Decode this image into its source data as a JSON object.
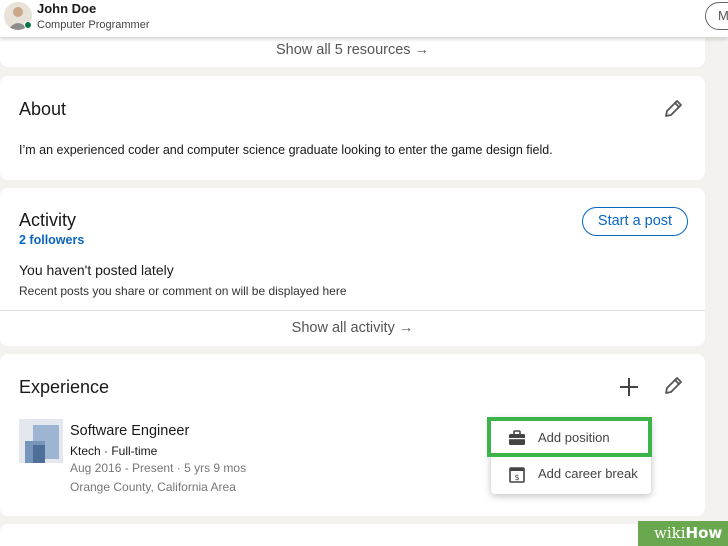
{
  "header": {
    "name": "John Doe",
    "headline": "Computer Programmer",
    "more_button_label": "M"
  },
  "resources": {
    "show_all_label": "Show all 5 resources",
    "arrow": "→"
  },
  "about": {
    "title": "About",
    "text": "I’m an experienced coder and computer science graduate looking to enter the game design field.",
    "edit_icon": "pencil-icon"
  },
  "activity": {
    "title": "Activity",
    "followers": "2 followers",
    "start_post_label": "Start a post",
    "empty_title": "You haven't posted lately",
    "empty_text": "Recent posts you share or comment on will be displayed here",
    "show_all_label": "Show all activity",
    "arrow": "→"
  },
  "experience": {
    "title": "Experience",
    "add_icon": "plus-icon",
    "edit_icon": "pencil-icon",
    "items": [
      {
        "role": "Software Engineer",
        "company": "Ktech · Full-time",
        "dates": "Aug 2016 - Present · 5 yrs 9 mos",
        "location": "Orange County, California Area"
      }
    ]
  },
  "add_menu": {
    "items": [
      {
        "label": "Add position",
        "icon": "briefcase-icon",
        "highlighted": true
      },
      {
        "label": "Add career break",
        "icon": "calendar-icon",
        "highlighted": false
      }
    ]
  },
  "watermark": {
    "wiki": "wiki",
    "how": "How"
  },
  "colors": {
    "accent": "#0a66c2",
    "highlight": "#3cb44a",
    "online": "#057642",
    "watermark_bg": "#6aa84f"
  }
}
